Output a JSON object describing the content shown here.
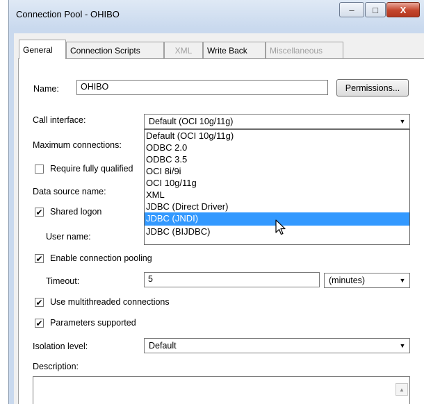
{
  "window": {
    "title": "Connection Pool - OHIBO",
    "minimize": "–",
    "maximize": "□",
    "close": "X"
  },
  "tabs": [
    {
      "label": "General",
      "active": true,
      "enabled": true
    },
    {
      "label": "Connection Scripts",
      "active": false,
      "enabled": true
    },
    {
      "label": "XML",
      "active": false,
      "enabled": false
    },
    {
      "label": "Write Back",
      "active": false,
      "enabled": true
    },
    {
      "label": "Miscellaneous",
      "active": false,
      "enabled": false
    }
  ],
  "form": {
    "name_label": "Name:",
    "name_value": "OHIBO",
    "permissions_button": "Permissions...",
    "call_interface_label": "Call interface:",
    "call_interface_value": "Default (OCI 10g/11g)",
    "max_connections_label": "Maximum connections:",
    "require_fully_qualified_label": "Require fully qualified",
    "require_fully_qualified_checked": false,
    "data_source_label": "Data source name:",
    "shared_logon_label": "Shared logon",
    "shared_logon_checked": true,
    "user_name_label": "User name:",
    "enable_pooling_label": "Enable connection pooling",
    "enable_pooling_checked": true,
    "timeout_label": "Timeout:",
    "timeout_value": "5",
    "timeout_unit": "(minutes)",
    "multithreaded_label": "Use multithreaded connections",
    "multithreaded_checked": true,
    "parameters_label": "Parameters supported",
    "parameters_checked": true,
    "isolation_label": "Isolation level:",
    "isolation_value": "Default",
    "description_label": "Description:"
  },
  "call_interface_options": [
    "Default (OCI 10g/11g)",
    "ODBC 2.0",
    "ODBC 3.5",
    "OCI 8i/9i",
    "OCI 10g/11g",
    "XML",
    "JDBC (Direct Driver)",
    "JDBC (JNDI)",
    "JDBC (BIJDBC)"
  ],
  "call_interface_highlighted": "JDBC (JNDI)",
  "colors": {
    "selection": "#3399ff",
    "titlebar": "#c9d9ee",
    "close_button": "#c4462c"
  },
  "icons": {
    "dropdown_arrow": "▼",
    "check_mark": "✔",
    "scroll_up": "▲"
  }
}
